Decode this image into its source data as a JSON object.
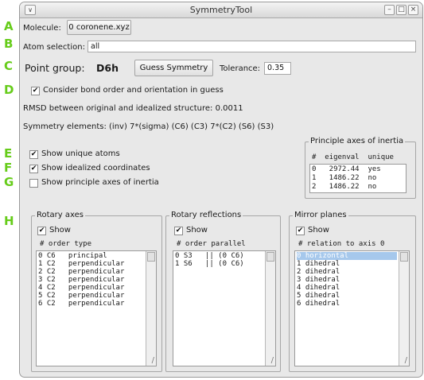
{
  "markers": [
    "A",
    "B",
    "C",
    "D",
    "E",
    "F",
    "G",
    "H"
  ],
  "window": {
    "title": "SymmetryTool",
    "menu_glyph": "∨",
    "min_glyph": "–",
    "max_glyph": "□",
    "close_glyph": "×"
  },
  "molecule": {
    "label": "Molecule:",
    "button": "0 coronene.xyz"
  },
  "atom_selection": {
    "label": "Atom selection:",
    "value": "all"
  },
  "point_group": {
    "label": "Point group:",
    "value": "D6h",
    "guess_button": "Guess Symmetry",
    "tolerance_label": "Tolerance:",
    "tolerance_value": "0.35"
  },
  "consider_bond": {
    "checked": true,
    "label": "Consider bond order and orientation in guess"
  },
  "rmsd": "RMSD between original and idealized structure: 0.0011",
  "symmetry_elements": "Symmetry elements:  (inv) 7*(sigma) (C6) (C3) 7*(C2) (S6) (S3)",
  "options": [
    {
      "label": "Show unique atoms",
      "checked": true
    },
    {
      "label": "Show idealized coordinates",
      "checked": true
    },
    {
      "label": "Show principle axes of inertia",
      "checked": false
    }
  ],
  "inertia": {
    "title": "Principle axes of inertia",
    "header": "#  eigenval  unique",
    "rows": [
      "0   2972.44  yes",
      "1   1486.22  no",
      "2   1486.22  no"
    ]
  },
  "rotary_axes": {
    "title": "Rotary axes",
    "show_label": "Show",
    "show_checked": true,
    "header": "# order type",
    "rows": [
      "0 C6   principal",
      "1 C2   perpendicular",
      "2 C2   perpendicular",
      "3 C2   perpendicular",
      "4 C2   perpendicular",
      "5 C2   perpendicular",
      "6 C2   perpendicular"
    ]
  },
  "rotary_reflections": {
    "title": "Rotary reflections",
    "show_label": "Show",
    "show_checked": true,
    "header": "# order parallel",
    "rows": [
      "0 S3   || (0 C6)",
      "1 S6   || (0 C6)"
    ]
  },
  "mirror_planes": {
    "title": "Mirror planes",
    "show_label": "Show",
    "show_checked": true,
    "header": "# relation to axis 0",
    "rows": [
      "0 horizontal",
      "1 dihedral",
      "2 dihedral",
      "3 dihedral",
      "4 dihedral",
      "5 dihedral",
      "6 dihedral"
    ],
    "selected_index": 0
  },
  "check_glyph": "✔",
  "resize_glyph": "/"
}
